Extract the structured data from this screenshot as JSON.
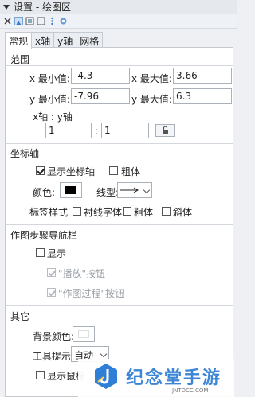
{
  "window": {
    "title": "设置 - 绘图区"
  },
  "tabs": [
    "常规",
    "x轴",
    "y轴",
    "网格"
  ],
  "range": {
    "heading": "范围",
    "x_min_label": "x 最小值:",
    "x_min": "-4.3",
    "x_max_label": "x 最大值:",
    "x_max": "3.66",
    "y_min_label": "y 最小值:",
    "y_min": "-7.96",
    "y_max_label": "y 最大值:",
    "y_max": "6.3",
    "ratio_label": "x轴 : y轴",
    "ratio_x": "1",
    "ratio_sep": ":",
    "ratio_y": "1"
  },
  "axes": {
    "heading": "坐标轴",
    "show_axes_label": "显示坐标轴",
    "show_axes_checked": true,
    "bold_label": "粗体",
    "bold_checked": false,
    "color_label": "颜色:",
    "color": "#000000",
    "line_type_label": "线型:",
    "label_style_label": "标签样式",
    "serif_label": "衬线字体",
    "serif_checked": false,
    "label_bold_label": "粗体",
    "label_bold_checked": false,
    "italic_label": "斜体",
    "italic_checked": false
  },
  "nav": {
    "heading": "作图步骤导航栏",
    "show_label": "显示",
    "show_checked": false,
    "play_label": "\"播放\"按钮",
    "play_checked": true,
    "process_label": "\"作图过程\"按钮",
    "process_checked": true
  },
  "other": {
    "heading": "其它",
    "bg_color_label": "背景颜色:",
    "bg_color": "#ffffff",
    "tooltip_label": "工具提示:",
    "tooltip_value": "自动",
    "show_mouse_label": "显示鼠标"
  },
  "watermark": {
    "text": "纪念堂手游",
    "sub": "JNTDCC.COM"
  }
}
